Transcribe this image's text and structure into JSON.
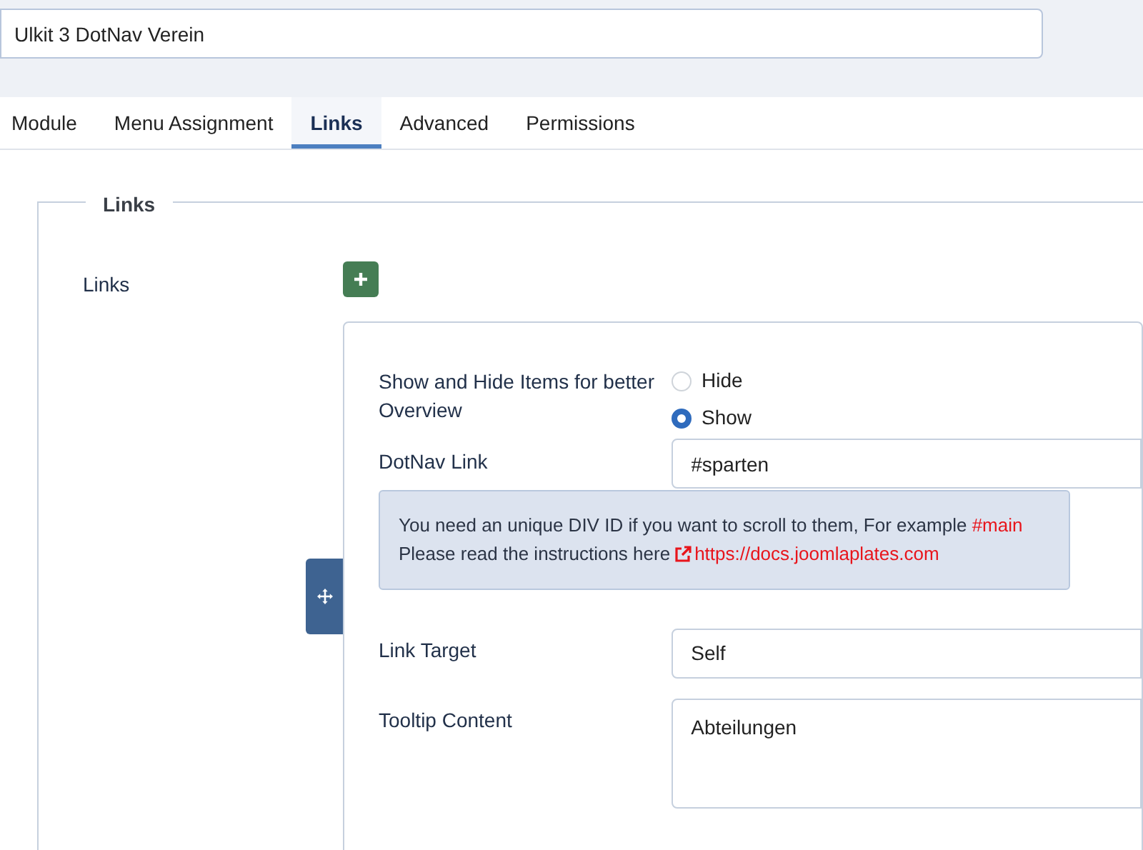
{
  "title_field": {
    "value": "Ulkit 3 DotNav Verein"
  },
  "tabs": [
    {
      "label": "Module",
      "selected": false
    },
    {
      "label": "Menu Assignment",
      "selected": false
    },
    {
      "label": "Links",
      "selected": true
    },
    {
      "label": "Advanced",
      "selected": false
    },
    {
      "label": "Permissions",
      "selected": false
    }
  ],
  "fieldset": {
    "legend": "Links",
    "label": "Links",
    "item": {
      "show_hide": {
        "label": "Show and Hide Items for better Overview",
        "options": [
          {
            "label": "Hide",
            "selected": false
          },
          {
            "label": "Show",
            "selected": true
          }
        ]
      },
      "dotnav_link": {
        "label": "DotNav Link",
        "value": "#sparten"
      },
      "alert": {
        "line_1": "You need an unique DIV ID if you want to scroll to them, For example",
        "example": "#main",
        "line_2": "Please read the instructions here",
        "link": "https://docs.joomlaplates.com"
      },
      "link_target": {
        "label": "Link Target",
        "value": "Self"
      },
      "tooltip_content": {
        "label": "Tooltip Content",
        "value": "Abteilungen"
      }
    }
  }
}
